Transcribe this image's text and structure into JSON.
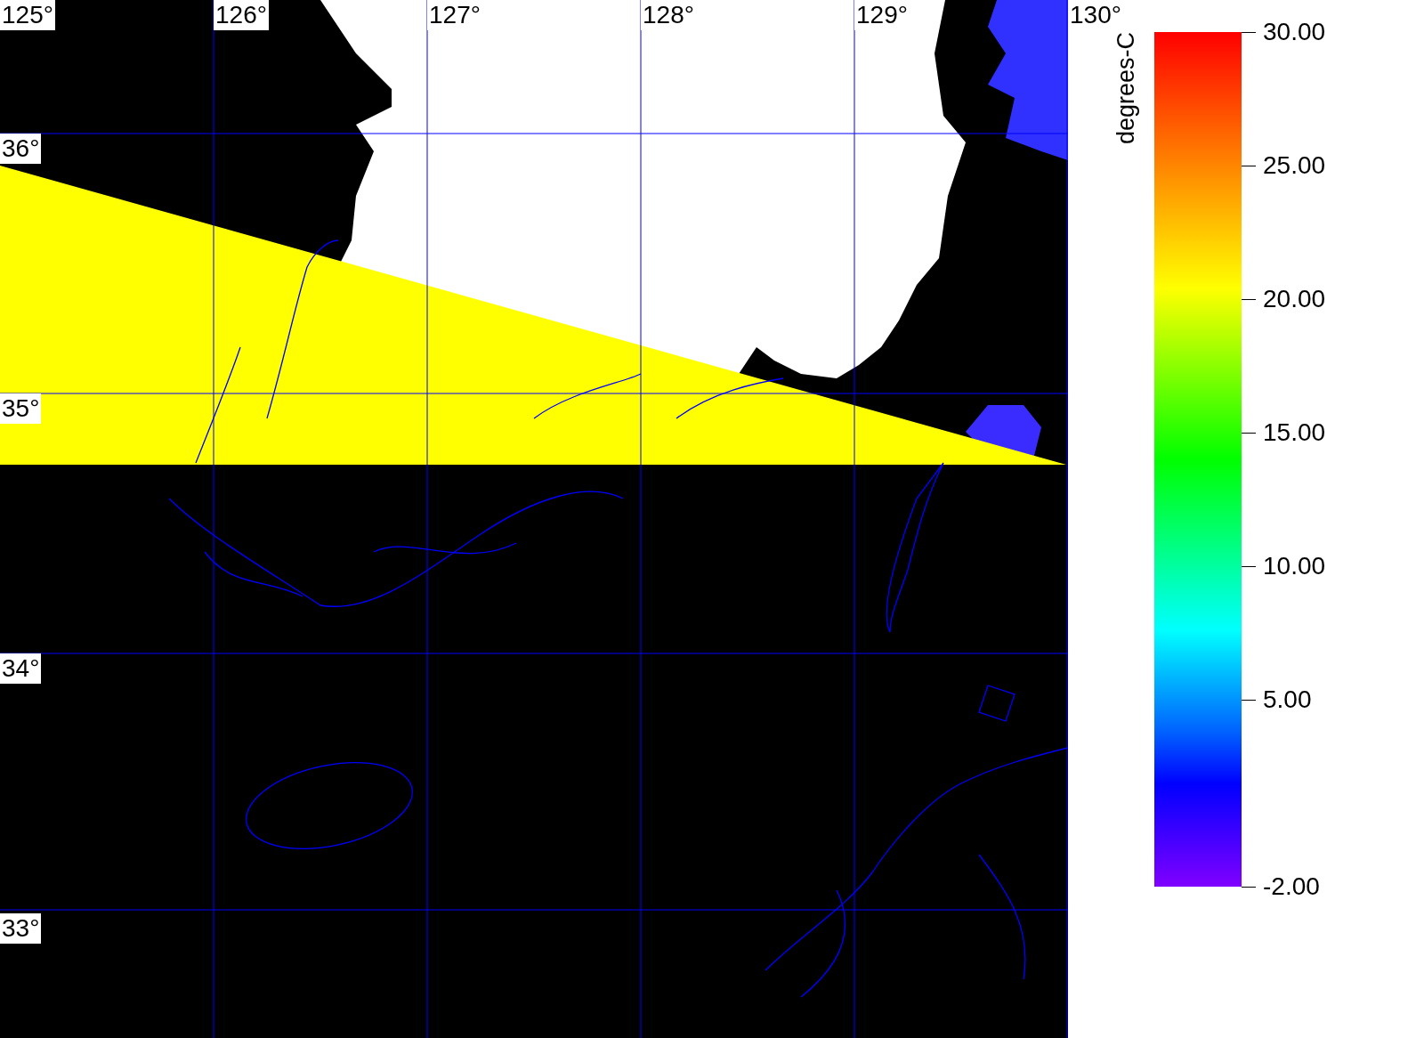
{
  "map": {
    "longitude_labels": [
      "125°",
      "126°",
      "127°",
      "128°",
      "129°",
      "130°"
    ],
    "latitude_labels": [
      "36°",
      "35°",
      "34°",
      "33°"
    ]
  },
  "colorbar": {
    "title": "degrees-C",
    "ticks": [
      "30.00",
      "25.00",
      "20.00",
      "15.00",
      "10.00",
      "5.00",
      "-2.00"
    ]
  }
}
